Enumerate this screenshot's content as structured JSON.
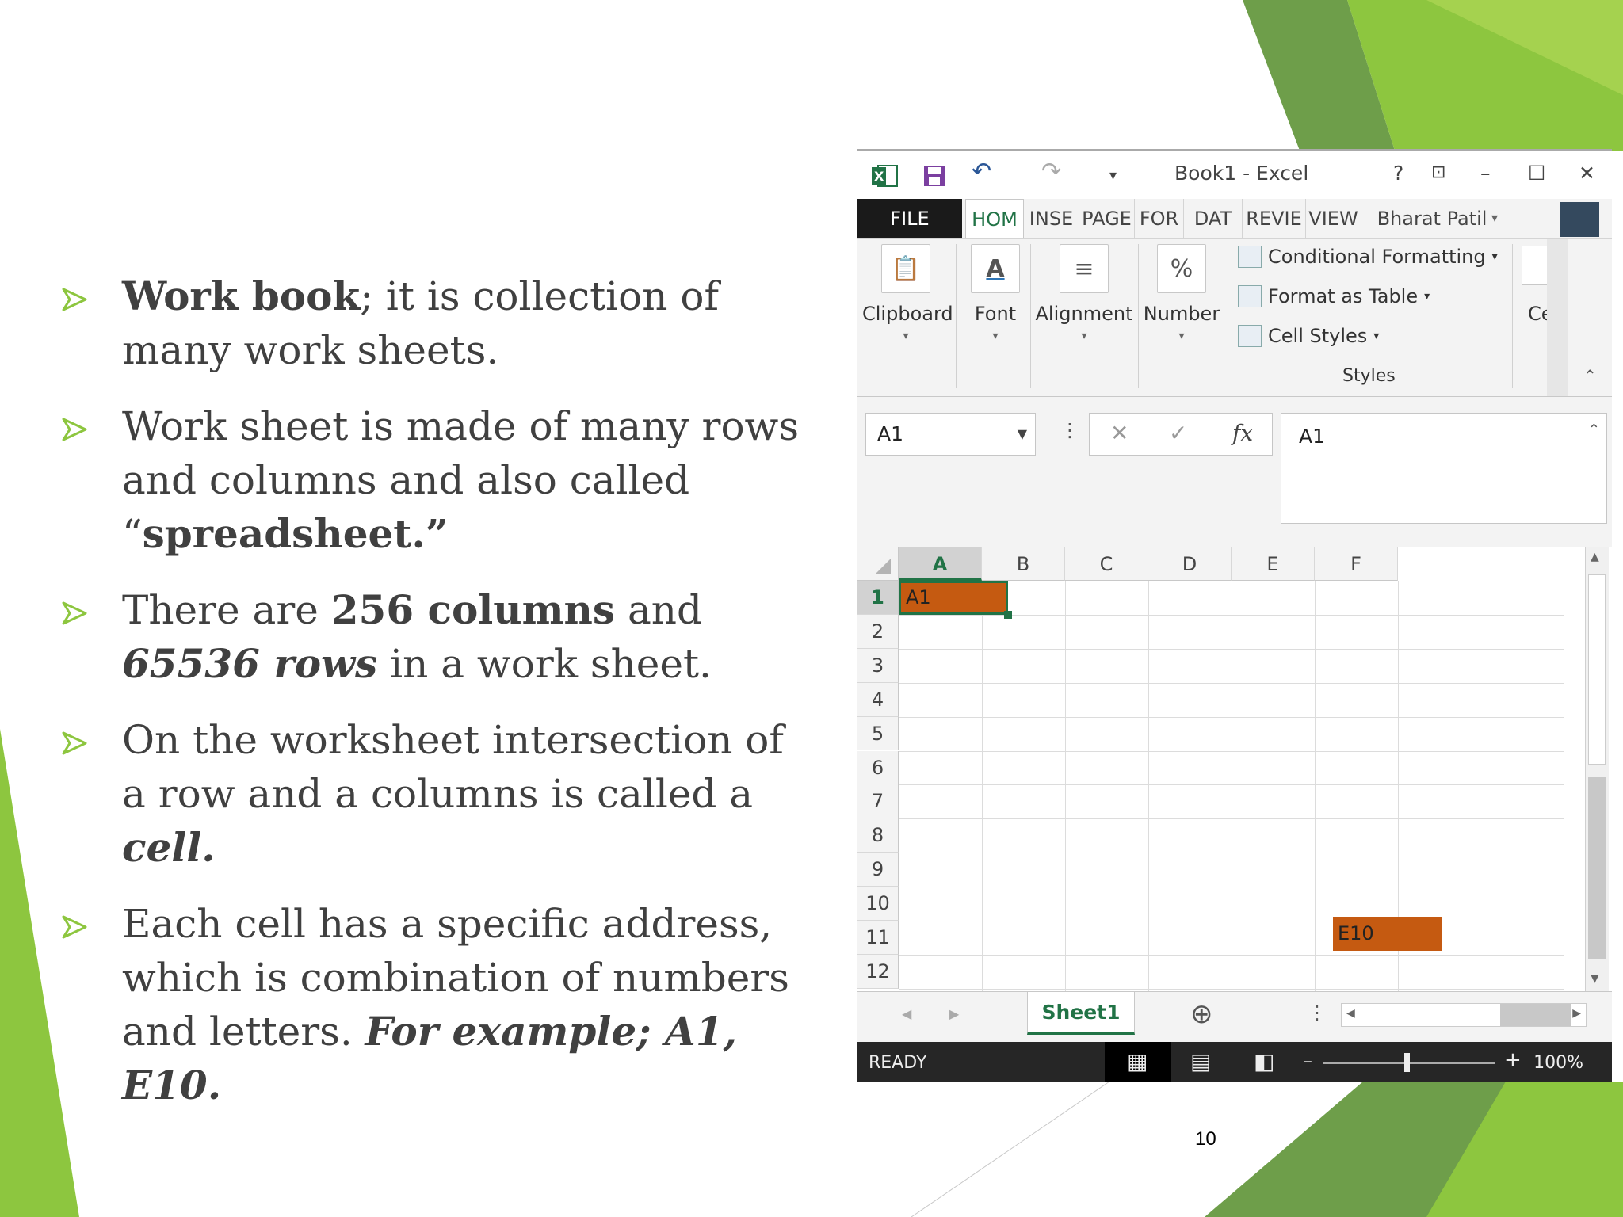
{
  "slide": {
    "page_number": "10",
    "accent_color": "#8dc63f",
    "bullets": [
      {
        "parts": [
          {
            "text": "Work book",
            "style": "b"
          },
          {
            "text": "; it is collection of many work sheets.",
            "style": ""
          }
        ]
      },
      {
        "parts": [
          {
            "text": "Work sheet is made of many rows and columns and also called “",
            "style": ""
          },
          {
            "text": "spreadsheet.”",
            "style": "b"
          }
        ]
      },
      {
        "parts": [
          {
            "text": "There are ",
            "style": ""
          },
          {
            "text": "256 columns",
            "style": "b"
          },
          {
            "text": " and ",
            "style": ""
          },
          {
            "text": "65536 rows",
            "style": "bi"
          },
          {
            "text": " in a work sheet.",
            "style": ""
          }
        ]
      },
      {
        "parts": [
          {
            "text": "On the worksheet intersection of a row and a columns is called a ",
            "style": ""
          },
          {
            "text": "cell.",
            "style": "bi"
          }
        ]
      },
      {
        "parts": [
          {
            "text": "Each cell has a specific address, which is combination of numbers and letters. ",
            "style": ""
          },
          {
            "text": "For example; A1, E10.",
            "style": "bi"
          }
        ]
      }
    ]
  },
  "excel": {
    "window_title": "Book1 - Excel",
    "help": "?",
    "user_name": "Bharat Patil",
    "tabs": [
      "FILE",
      "HOM",
      "INSE",
      "PAGE",
      "FOR",
      "DAT",
      "REVIE",
      "VIEW"
    ],
    "ribbon_groups": [
      "Clipboard",
      "Font",
      "Alignment",
      "Number"
    ],
    "styles_items": [
      "Conditional Formatting",
      "Format as Table",
      "Cell Styles"
    ],
    "styles_group_label": "Styles",
    "cells_group_label": "Ce",
    "name_box": "A1",
    "formula_content": "A1",
    "fx_label": "fx",
    "columns": [
      "A",
      "B",
      "C",
      "D",
      "E",
      "F"
    ],
    "rows": [
      "1",
      "2",
      "3",
      "4",
      "5",
      "6",
      "7",
      "8",
      "9",
      "10",
      "11",
      "12"
    ],
    "cell_a1": "A1",
    "cell_e10": "E10",
    "cell_fill_color": "#c55a11",
    "sheet_tab": "Sheet1",
    "status": "READY",
    "zoom": "100%"
  }
}
